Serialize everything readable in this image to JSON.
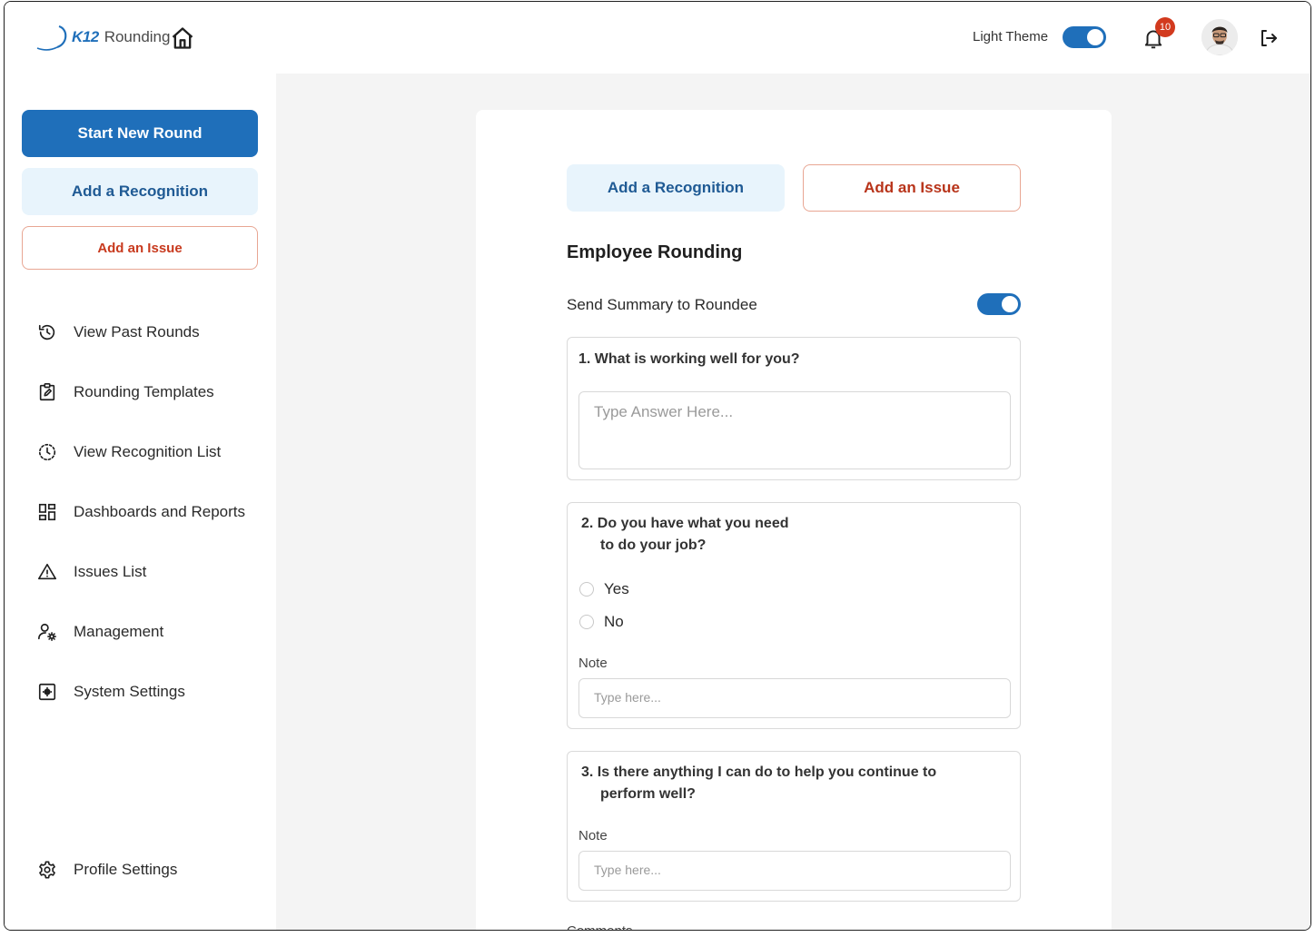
{
  "brand": {
    "logo_mark": "K12",
    "logo_text": "Rounding"
  },
  "header": {
    "theme_label": "Light Theme",
    "theme_toggle_on": true,
    "notification_count": "10",
    "accent_color": "#1f6fba",
    "badge_color": "#d23a1e"
  },
  "sidebar": {
    "start_round": "Start New Round",
    "add_recognition": "Add a Recognition",
    "add_issue": "Add an Issue",
    "items": [
      {
        "label": "View Past Rounds",
        "icon": "history-icon"
      },
      {
        "label": "Rounding Templates",
        "icon": "clipboard-edit-icon"
      },
      {
        "label": "View Recognition List",
        "icon": "clock-dashed-icon"
      },
      {
        "label": "Dashboards and Reports",
        "icon": "dashboard-grid-icon"
      },
      {
        "label": "Issues List",
        "icon": "warning-triangle-icon"
      },
      {
        "label": "Management",
        "icon": "user-gear-icon"
      },
      {
        "label": "System Settings",
        "icon": "settings-box-icon"
      }
    ],
    "profile_settings": "Profile Settings"
  },
  "form": {
    "tab_recognition": "Add a Recognition",
    "tab_issue": "Add an Issue",
    "title": "Employee Rounding",
    "send_summary_label": "Send Summary to Roundee",
    "send_summary_on": true,
    "q1": {
      "text": "1. What is working well for you?",
      "placeholder": "Type Answer Here..."
    },
    "q2": {
      "line1": "2. Do you have what you need",
      "line2": "to do your job?",
      "options": [
        "Yes",
        "No"
      ],
      "note_label": "Note",
      "note_placeholder": "Type here..."
    },
    "q3": {
      "line1": "3. Is there anything I can do to help you continue to",
      "line2": "perform well?",
      "note_label": "Note",
      "note_placeholder": "Type here..."
    },
    "next_label_partial": "Comments"
  }
}
